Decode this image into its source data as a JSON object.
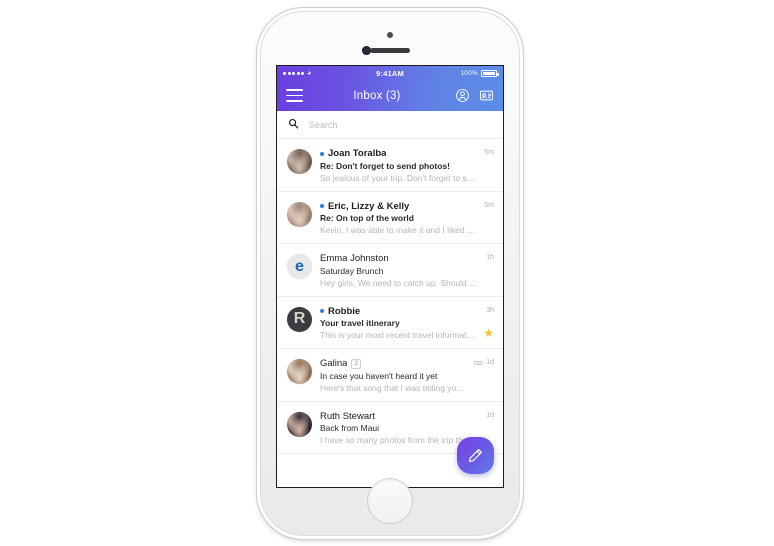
{
  "device": {
    "name": "white-iphone",
    "earpiece": "earpiece-speaker",
    "camera": "front-camera",
    "home_button": "home-button"
  },
  "status_bar": {
    "carrier_signal": "signal-dots",
    "wifi_icon": "wifi-icon",
    "time": "9:41AM",
    "battery_percent": "100%",
    "battery_icon": "battery-full-icon"
  },
  "nav_bar": {
    "menu_icon": "hamburger-menu-icon",
    "title": "Inbox (3)",
    "account_icon": "account-circle-icon",
    "contacts_icon": "contact-card-icon"
  },
  "search": {
    "icon": "search-icon",
    "placeholder": "Search",
    "value": ""
  },
  "colors": {
    "gradient_start": "#6a3fe0",
    "gradient_end": "#5b8de8",
    "unread_dot": "#2f7bf0",
    "star": "#f5c033",
    "preview_text": "#b6b6b6"
  },
  "fab": {
    "name": "compose-button",
    "icon": "pencil-compose-icon"
  },
  "mail_list": [
    {
      "sender": "Joan Toralba",
      "subject": "Re: Don't forget to send photos!",
      "preview": "So jealous of your trip. Don't forget to share...",
      "time": "5m",
      "unread": true,
      "starred": false,
      "attachment": false,
      "count": "",
      "avatar_type": "photo",
      "avatar_label": "",
      "avatar_color_a": "#6f5b4e",
      "avatar_color_b": "#cfc2b4"
    },
    {
      "sender": "Eric, Lizzy & Kelly",
      "subject": "Re: On top of the world",
      "preview": "Kevin, I was able to make it and I liked what...",
      "time": "5m",
      "unread": true,
      "starred": false,
      "attachment": false,
      "count": "",
      "avatar_type": "photo",
      "avatar_label": "",
      "avatar_color_a": "#9a7f72",
      "avatar_color_b": "#e3cfc0"
    },
    {
      "sender": "Emma Johnston",
      "subject": "Saturday Brunch",
      "preview": "Hey girls, We need to catch up. Should I bri...",
      "time": "1h",
      "unread": false,
      "starred": false,
      "attachment": false,
      "count": "",
      "avatar_type": "letter",
      "avatar_label": "e",
      "avatar_color_a": "#e8e8e8",
      "avatar_color_b": "#1565c0"
    },
    {
      "sender": "Robbie",
      "subject": "Your travel itinerary",
      "preview": "This is your most recent travel informati...",
      "time": "3h",
      "unread": true,
      "starred": true,
      "attachment": false,
      "count": "",
      "avatar_type": "letter",
      "avatar_label": "R",
      "avatar_color_a": "#3b3b42",
      "avatar_color_b": "#d9d2cc"
    },
    {
      "sender": "Galina",
      "subject": "In case you haven't heard it yet",
      "preview": "Here's that song that I was telling you about...",
      "time": "1d",
      "unread": false,
      "starred": false,
      "attachment": true,
      "count": "2",
      "avatar_type": "photo",
      "avatar_label": "",
      "avatar_color_a": "#8d6f58",
      "avatar_color_b": "#e8d9c6"
    },
    {
      "sender": "Ruth Stewart",
      "subject": "Back from Maui",
      "preview": "I have so many photos from the trip that I w...",
      "time": "1d",
      "unread": false,
      "starred": false,
      "attachment": false,
      "count": "",
      "avatar_type": "photo",
      "avatar_label": "",
      "avatar_color_a": "#2a2630",
      "avatar_color_b": "#d8b9a5"
    }
  ]
}
